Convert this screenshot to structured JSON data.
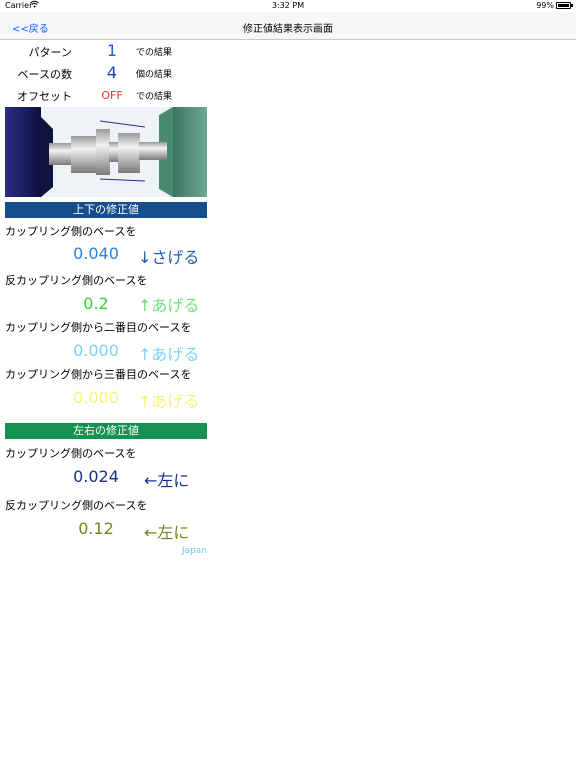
{
  "status": {
    "carrier": "Carrier",
    "wifi_icon": "wifi-icon",
    "time": "3:32 PM",
    "battery": "99%",
    "battery_level": 0.99
  },
  "nav": {
    "back_label": "<<戻る",
    "title": "修正値結果表示画面"
  },
  "info": [
    {
      "label": "パターン",
      "value": "1",
      "suffix": "での結果",
      "color": "#1a5fd1"
    },
    {
      "label": "ベースの数",
      "value": "4",
      "suffix": "個の結果",
      "color": "#1a3fbf"
    },
    {
      "label": "オフセット",
      "value": "OFF",
      "suffix": "での結果",
      "color": "#ff2a2a"
    }
  ],
  "vertical": {
    "header": "上下の修正値",
    "header_color": "#154d8d",
    "items": [
      {
        "desc": "カップリング側のベースを",
        "amount": "0.040",
        "direction": "↓さげる",
        "amount_color": "#2f7fe0",
        "dir_color": "#1f5fb0"
      },
      {
        "desc": "反カップリング側のベースを",
        "amount": "0.2",
        "direction": "↑あげる",
        "amount_color": "#2fd63a",
        "dir_color": "#6ee27a"
      },
      {
        "desc": "カップリング側から二番目のベースを",
        "amount": "0.000",
        "direction": "↑あげる",
        "amount_color": "#7fd2f5",
        "dir_color": "#7fd2f5"
      },
      {
        "desc": "カップリング側から三番目のベースを",
        "amount": "0.000",
        "direction": "↑あげる",
        "amount_color": "#f5f57a",
        "dir_color": "#f5f57a"
      }
    ]
  },
  "horizontal": {
    "header": "左右の修正値",
    "header_color": "#169150",
    "items": [
      {
        "desc": "カップリング側のベースを",
        "amount": "0.024",
        "direction": "←左に",
        "amount_color": "#1a2e87",
        "dir_color": "#1a2e87"
      },
      {
        "desc": "反カップリング側のベースを",
        "amount": "0.12",
        "direction": "←左に",
        "amount_color": "#6b8a1c",
        "dir_color": "#6b8a1c"
      }
    ]
  },
  "footer": "Japan"
}
